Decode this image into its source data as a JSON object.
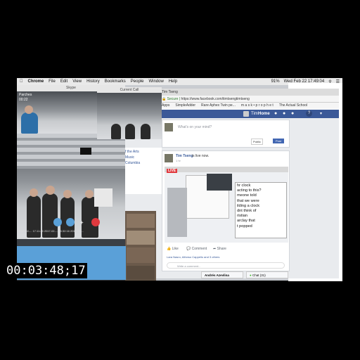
{
  "timecode": "00:03:48;17",
  "menubar": {
    "app": "Chrome",
    "items": [
      "File",
      "Edit",
      "View",
      "History",
      "Bookmarks",
      "People",
      "Window",
      "Help"
    ],
    "clock": "Wed Feb 22  17:49:04",
    "battery": "91%"
  },
  "skype": {
    "title": "Skype",
    "caller_name": "Parches",
    "caller_time": "00:22",
    "timestamps": "2017-02-... 17:11:45   2017-02-... 16:32:16   2017-02-..."
  },
  "groupcall": {
    "title": "Current Call"
  },
  "sidebar_links": [
    "f the Arts",
    "Music",
    "Columbia"
  ],
  "browser": {
    "tab_label": "Tim Tseng",
    "secure_label": "Secure",
    "url": "https://www.facebook.com/timtsengtimtseng",
    "bookmarks": [
      "Apps",
      "SimpleAdder",
      "Rare Aphex Twin pe...",
      "m a s k • p r o p h e t",
      "The Actual School"
    ]
  },
  "facebook": {
    "nav_name": "Tim",
    "nav_home": "Home",
    "composer_placeholder": "What's on your mind?",
    "privacy": "Public",
    "post_button": "Post",
    "post_author": "Tim Tseng",
    "post_status": "is live now.",
    "post_time": "1 hr",
    "live_badge": "LIVE",
    "overlay_text": [
      "hr clock",
      "acting to this?",
      "meone told",
      "that we were",
      "ilding a clock",
      "dnt think of",
      "ristian",
      "arclay that",
      "t popped"
    ],
    "like_label": "Like",
    "comment_label": "Comment",
    "share_label": "Share",
    "reactions": "Lara Nasro, Alfonso Cappello and 3 others",
    "comment_placeholder": "Write a comment...",
    "chat_contact": "Andrés Azevlina",
    "chat_label": "Chat (31)"
  },
  "slide": {
    "lines": [
      "s?",
      "ere",
      "ck"
    ]
  },
  "colors": {
    "facebook_blue": "#3b5998",
    "skype_blue": "#5aa0d8",
    "end_call_red": "#e0393e"
  }
}
